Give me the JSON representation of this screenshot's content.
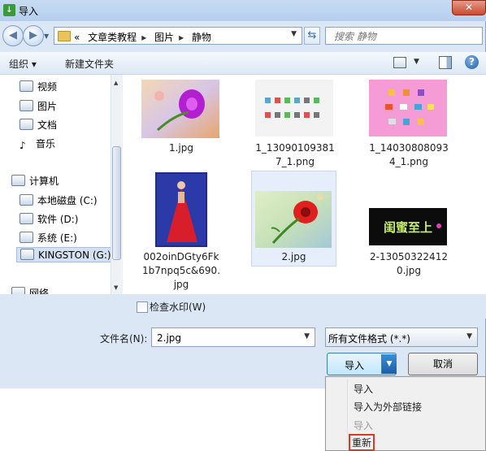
{
  "window": {
    "title": "导入",
    "app_icon": "import-app-icon",
    "close_label": "✕"
  },
  "nav": {
    "back_icon": "back-arrow-icon",
    "forward_icon": "forward-arrow-icon",
    "address": {
      "prefix": "«",
      "crumbs": [
        "文章类教程",
        "图片",
        "静物"
      ]
    },
    "search_placeholder": "搜索 静物"
  },
  "toolbar": {
    "organize": "组织 ▾",
    "new_folder": "新建文件夹",
    "help": "?"
  },
  "sidebar": {
    "items": [
      {
        "label": "视频",
        "icon": "video-library-icon"
      },
      {
        "label": "图片",
        "icon": "pictures-library-icon"
      },
      {
        "label": "文档",
        "icon": "documents-library-icon"
      },
      {
        "label": "音乐",
        "icon": "music-library-icon"
      },
      {
        "label": "计算机",
        "icon": "computer-icon"
      },
      {
        "label": "本地磁盘 (C:)",
        "icon": "local-disk-icon"
      },
      {
        "label": "软件 (D:)",
        "icon": "drive-icon"
      },
      {
        "label": "系统 (E:)",
        "icon": "drive-icon"
      },
      {
        "label": "KINGSTON (G:)",
        "icon": "usb-drive-icon"
      },
      {
        "label": "网络",
        "icon": "network-icon"
      }
    ]
  },
  "files": [
    {
      "name": "1.jpg",
      "line2": "",
      "line3": ""
    },
    {
      "name": "1_13090109381",
      "line2": "7_1.png",
      "line3": ""
    },
    {
      "name": "1_14030808093",
      "line2": "4_1.png",
      "line3": ""
    },
    {
      "name": "002oinDGty6Fk",
      "line2": "1b7npq5c&690.",
      "line3": "jpg"
    },
    {
      "name": "2.jpg",
      "line2": "",
      "line3": ""
    },
    {
      "name": "2-13050322412",
      "line2": "0.jpg",
      "line3": ""
    }
  ],
  "thumb_text": {
    "neon": "闺蜜至上"
  },
  "options": {
    "watermark_label": "检查水印(W)"
  },
  "filename": {
    "label": "文件名(N):",
    "value": "2.jpg"
  },
  "filter": {
    "selected": "所有文件格式 (*.*)"
  },
  "buttons": {
    "import": "导入",
    "cancel": "取消"
  },
  "menu": {
    "items": [
      "导入",
      "导入为外部链接",
      "导入",
      "重新"
    ]
  },
  "colors": {
    "accent": "#3c7fb1",
    "highlight_box": "#d83a2a"
  }
}
